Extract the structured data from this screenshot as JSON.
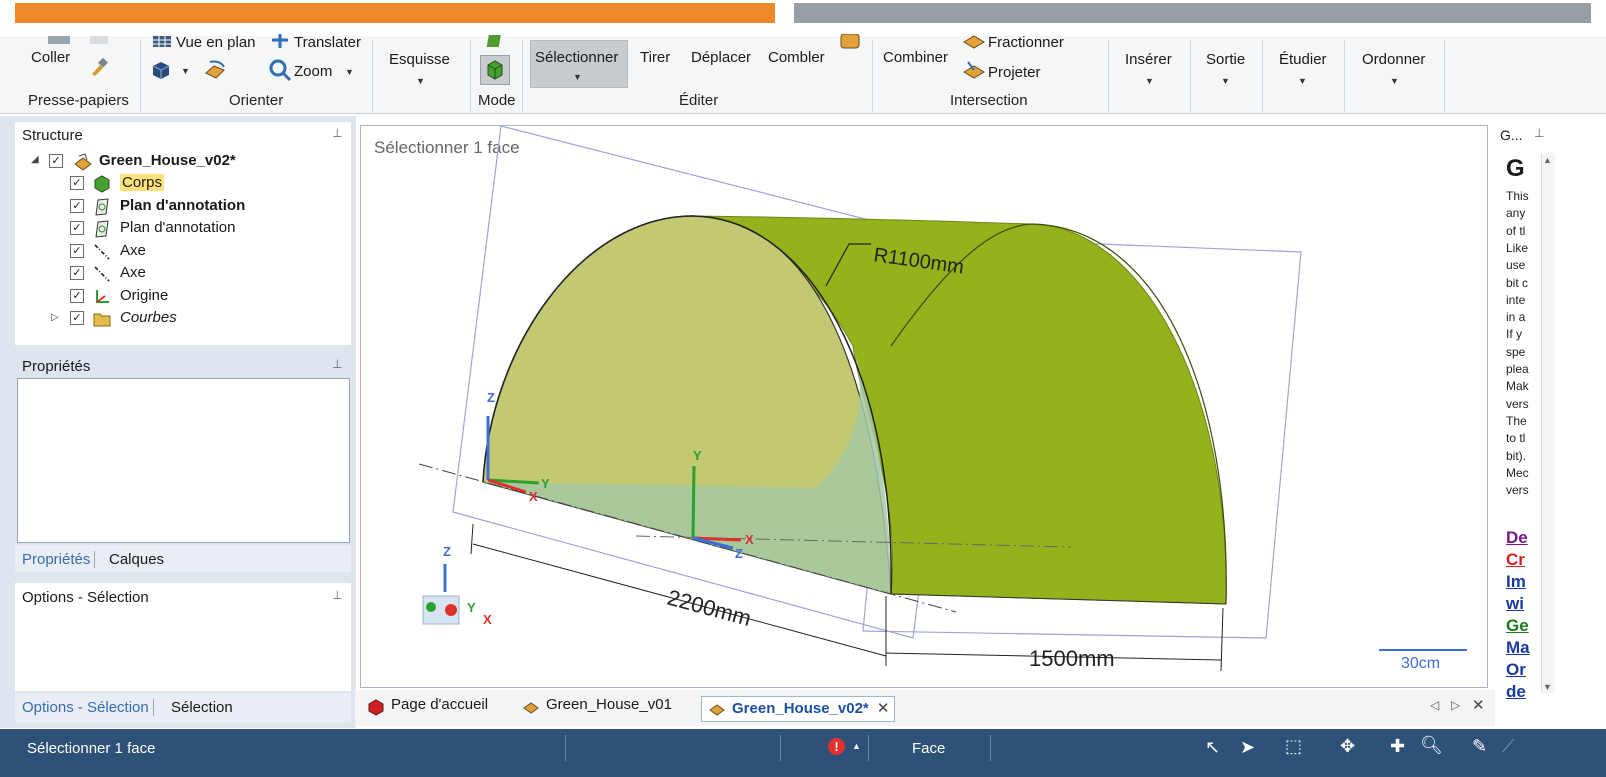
{
  "ribbon": {
    "clipboard": {
      "paste_label": "Coller",
      "group_label": "Presse-papiers"
    },
    "orient": {
      "plan_view_label": "Vue en plan",
      "translate_label": "Translater",
      "zoom_label": "Zoom",
      "group_label": "Orienter"
    },
    "sketch_label": "Esquisse",
    "mode_label": "Mode",
    "edit": {
      "select_label": "Sélectionner",
      "pull_label": "Tirer",
      "move_label": "Déplacer",
      "fill_label": "Combler",
      "group_label": "Éditer"
    },
    "intersection": {
      "combine_label": "Combiner",
      "split_label": "Fractionner",
      "project_label": "Projeter",
      "group_label": "Intersection"
    },
    "insert_label": "Insérer",
    "output_label": "Sortie",
    "study_label": "Étudier",
    "order_label": "Ordonner"
  },
  "structure": {
    "title": "Structure",
    "root": "Green_House_v02*",
    "items": [
      {
        "label": "Corps",
        "highlight": true,
        "bold": false,
        "italic": false,
        "icon": "body-icon"
      },
      {
        "label": "Plan d'annotation",
        "highlight": false,
        "bold": true,
        "italic": false,
        "icon": "annotation-plane-icon"
      },
      {
        "label": "Plan d'annotation",
        "highlight": false,
        "bold": false,
        "italic": false,
        "icon": "annotation-plane-icon"
      },
      {
        "label": "Axe",
        "highlight": false,
        "bold": false,
        "italic": false,
        "icon": "axis-icon"
      },
      {
        "label": "Axe",
        "highlight": false,
        "bold": false,
        "italic": false,
        "icon": "axis-icon"
      },
      {
        "label": "Origine",
        "highlight": false,
        "bold": false,
        "italic": false,
        "icon": "origin-icon"
      },
      {
        "label": "Courbes",
        "highlight": false,
        "bold": false,
        "italic": true,
        "icon": "folder-icon"
      }
    ]
  },
  "properties": {
    "title": "Propriétés",
    "tab_properties": "Propriétés",
    "tab_layers": "Calques"
  },
  "options": {
    "title": "Options - Sélection",
    "tab_options": "Options - Sélection",
    "tab_selection": "Sélection"
  },
  "viewport": {
    "hint": "Sélectionner 1 face",
    "dim_radius": "R1100mm",
    "dim_length": "2200mm",
    "dim_depth": "1500mm",
    "scale_label": "30cm",
    "axis_z": "Z",
    "axis_y": "Y",
    "axis_x": "X"
  },
  "doc_tabs": [
    {
      "label": "Page d'accueil",
      "active": false
    },
    {
      "label": "Green_House_v01",
      "active": false
    },
    {
      "label": "Green_House_v02*",
      "active": true
    }
  ],
  "help_panel": {
    "title": "G...",
    "heading": "G",
    "lines": [
      "This",
      "any",
      "of tl",
      "Like",
      "use",
      "bit c",
      "inte",
      "in a",
      "If y",
      "spe",
      "plea",
      "Mak",
      "vers",
      "The",
      "to tl",
      "bit).",
      "Mec",
      "vers"
    ],
    "links": [
      {
        "text": "De",
        "color": "#7a1a8a"
      },
      {
        "text": "Cr",
        "color": "#d02020"
      },
      {
        "text": "Im",
        "color": "#1a3aa0"
      },
      {
        "text": "wi",
        "color": "#1a3aa0"
      },
      {
        "text": "Ge",
        "color": "#1a7a1a"
      },
      {
        "text": "Ma",
        "color": "#1a3aa0"
      },
      {
        "text": "Or",
        "color": "#1a3aa0"
      },
      {
        "text": "de",
        "color": "#1a3aa0"
      }
    ]
  },
  "status": {
    "message": "Sélectionner 1 face",
    "filter": "Face"
  },
  "colors": {
    "accent_orange": "#f0892a",
    "status_blue": "#2e5178",
    "shape_green": "#93b21c",
    "shape_light": "#c3c873"
  }
}
